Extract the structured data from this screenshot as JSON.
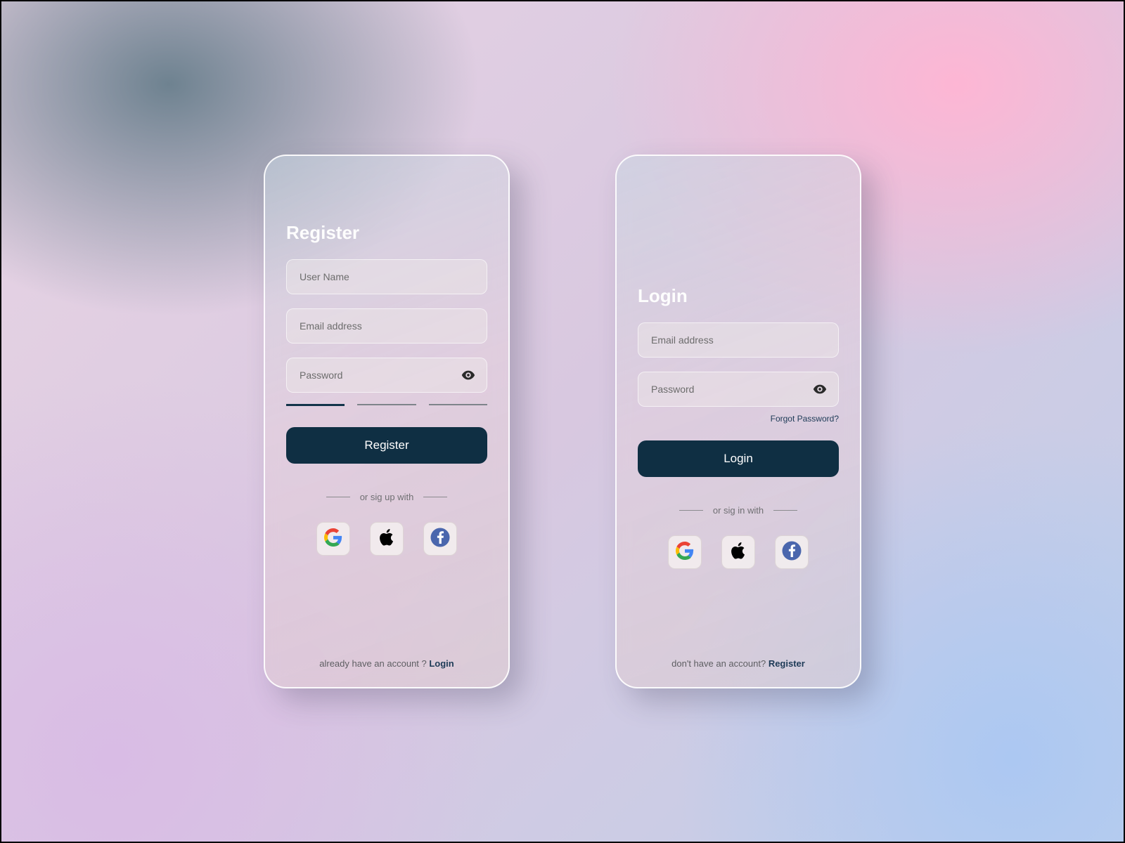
{
  "register": {
    "title": "Register",
    "username_placeholder": "User Name",
    "email_placeholder": "Email address",
    "password_placeholder": "Password",
    "button_label": "Register",
    "divider_text": "or sig up  with",
    "footer_prompt": "already have an account ? ",
    "footer_link": "Login"
  },
  "login": {
    "title": "Login",
    "email_placeholder": "Email address",
    "password_placeholder": "Password",
    "forgot_label": "Forgot Password?",
    "button_label": "Login",
    "divider_text": "or sig in  with",
    "footer_prompt": "don't have an account? ",
    "footer_link": "Register"
  },
  "colors": {
    "primary_button": "#0f2f43",
    "link": "#1d3a56"
  }
}
